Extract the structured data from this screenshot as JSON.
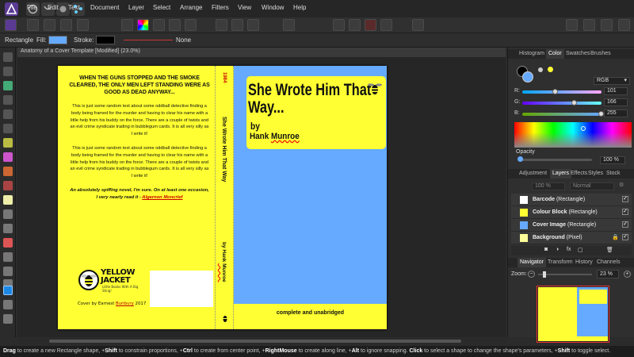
{
  "menubar": {
    "items": [
      "File",
      "Edit",
      "Text",
      "Document",
      "Layer",
      "Select",
      "Arrange",
      "Filters",
      "View",
      "Window",
      "Help"
    ]
  },
  "context": {
    "tool_name": "Rectangle",
    "fill_label": "Fill:",
    "stroke_label": "Stroke:",
    "stroke_value": "None",
    "fill_color": "#66aaff",
    "stroke_color": "#000000"
  },
  "document": {
    "tab_title": "Anatomy of a Cover Template [Modified] (23.0%)"
  },
  "back_cover": {
    "headline": "WHEN THE GUNS STOPPED AND THE SMOKE CLEARED, THE ONLY MEN LEFT STANDING WERE AS GOOD AS DEAD ANYWAY...",
    "para1": "This is just some random text about some oddball detective finding a body being framed for the murder and having to clear his name with a little help from his buddy on the force. There are a couple of twists and an evil crime syndicate trading in bubblegum cards. It is all very silly as I write it!",
    "para2": "This is just some random text about some oddball detective finding a body being framed for the murder and having to clear his name with a little help from his buddy on the force. There are a couple of twists and an evil crime syndicate trading in bubblegum cards. It is all very silly as I write it!",
    "quote": "An absolutely spiffing novel, I'm sure. On at least one occasion, I very nearly read it - ",
    "quote_author": "Algernon Moncrief",
    "logo_line1": "YELLOW",
    "logo_line2": "JACKET",
    "logo_small": "Little Books With A Big Sting!",
    "cover_by_prefix": "Cover by Earnest ",
    "cover_by_name": "Bunbury",
    "cover_by_year": " 2017"
  },
  "spine": {
    "top_label": "1984",
    "title": "She Wrote Him That Way",
    "author_prefix": "by Hank ",
    "author_name": "Munroe"
  },
  "front_cover": {
    "title": "She Wrote Him That Way...",
    "by": "by",
    "author_first": "Hank ",
    "author_last": "Munroe",
    "footer": "complete and unabridged"
  },
  "colors": {
    "cover_yellow": "#ffff33",
    "cover_blue": "#66aaff",
    "accent_red": "#cc0000"
  },
  "color_panel": {
    "tabs": [
      "Histogram",
      "Color",
      "Swatches",
      "Brushes"
    ],
    "active_tab": "Color",
    "mode": "RGB",
    "r_label": "R:",
    "g_label": "G:",
    "b_label": "B:",
    "r_value": "101",
    "g_value": "166",
    "b_value": "255",
    "r_level": 0.396,
    "g_level": 0.651,
    "b_level": 1.0,
    "opacity_label": "Opacity",
    "opacity_value": "100 %"
  },
  "layers_panel": {
    "tabs": [
      "Adjustment",
      "Layers",
      "Effects",
      "Styles",
      "Stock"
    ],
    "active_tab": "Layers",
    "opacity_value": "100 %",
    "blend_mode": "Normal",
    "layers": [
      {
        "name": "Barcode",
        "type": "(Rectangle)",
        "thumb": "#ffffff"
      },
      {
        "name": "Colour Block",
        "type": "(Rectangle)",
        "thumb": "#ffff33"
      },
      {
        "name": "Cover Image",
        "type": "(Rectangle)",
        "thumb": "#66aaff"
      },
      {
        "name": "Background",
        "type": "(Pixel)",
        "thumb": "#ffff99"
      }
    ]
  },
  "navigator_panel": {
    "tabs": [
      "Navigator",
      "Transform",
      "History",
      "Channels"
    ],
    "active_tab": "Navigator",
    "zoom_label": "Zoom:",
    "zoom_value": "23 %"
  },
  "statusbar": {
    "parts": [
      {
        "b": "Drag",
        "t": " to create a new Rectangle shape, +"
      },
      {
        "b": "Shift",
        "t": " to constrain proportions, +"
      },
      {
        "b": "Ctrl",
        "t": " to create from center point, +"
      },
      {
        "b": "RightMouse",
        "t": " to create along line, +"
      },
      {
        "b": "Alt",
        "t": " to ignore snapping. "
      },
      {
        "b": "Click",
        "t": " to select a shape to change the shape's parameters, +"
      },
      {
        "b": "Shift",
        "t": " to toggle select."
      }
    ]
  }
}
